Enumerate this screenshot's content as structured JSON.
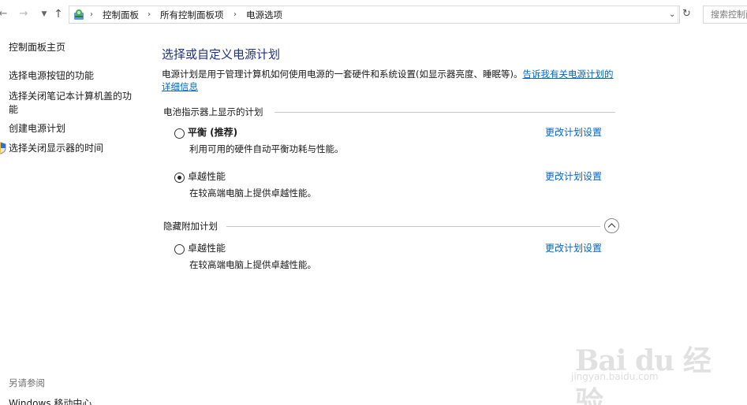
{
  "address_bar": {
    "crumbs": [
      "控制面板",
      "所有控制面板项",
      "电源选项"
    ],
    "search_placeholder": "搜索控制面"
  },
  "sidebar": {
    "home": "控制面板主页",
    "links": [
      "选择电源按钮的功能",
      "选择关闭笔记本计算机盖的功能",
      "创建电源计划",
      "选择关闭显示器的时间"
    ],
    "see_also": "另请参阅",
    "see_also_links": [
      "Windows 移动中心"
    ]
  },
  "main": {
    "title": "选择或自定义电源计划",
    "description": "电源计划是用于管理计算机如何使用电源的一套硬件和系统设置(如显示器亮度、睡眠等)。",
    "description_link": "告诉我有关电源计划的详细信息",
    "battery_section": "电池指示器上显示的计划",
    "hidden_section": "隐藏附加计划",
    "plans": [
      {
        "name": "平衡 (推荐)",
        "desc": "利用可用的硬件自动平衡功耗与性能。",
        "link": "更改计划设置",
        "selected": false
      },
      {
        "name": "卓越性能",
        "desc": "在较高端电脑上提供卓越性能。",
        "link": "更改计划设置",
        "selected": true
      },
      {
        "name": "卓越性能",
        "desc": "在较高端电脑上提供卓越性能。",
        "link": "更改计划设置",
        "selected": false
      }
    ]
  },
  "watermark": {
    "brand": "Bai du 经验",
    "url": "jingyan.baidu.com"
  },
  "icons": {
    "back": "back-arrow-icon",
    "forward": "forward-arrow-icon",
    "recent": "chevron-down-icon",
    "up": "up-arrow-icon",
    "control_panel": "control-panel-icon",
    "refresh": "refresh-icon",
    "shield": "shield-icon",
    "collapse": "chevron-up-icon"
  },
  "colors": {
    "title": "#1e3287",
    "link": "#0066cc"
  }
}
